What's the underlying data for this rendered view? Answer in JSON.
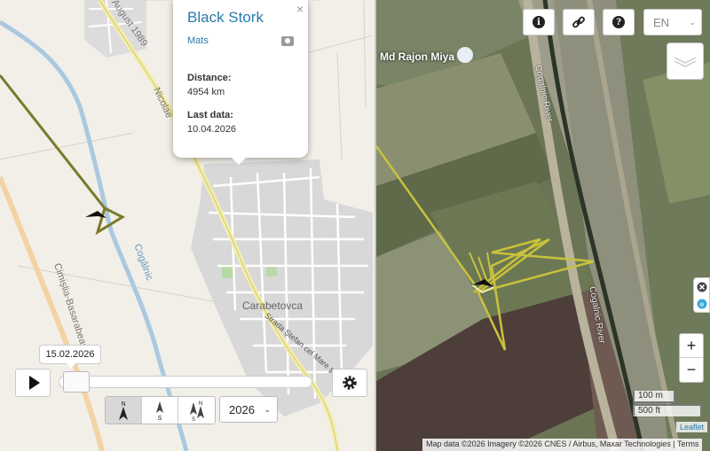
{
  "map_left": {
    "labels": {
      "road_top": "August 1989",
      "road_mid": "Nicolae",
      "river": "Cogâlnic",
      "road_left": "Cimișlia-Basarabeasca",
      "town": "Carabetovca",
      "street": "Strada Ștefan cel Mare și Sfânt"
    }
  },
  "popup": {
    "close": "×",
    "title": "Black Stork",
    "user": "Mats",
    "camera_icon": "camera-icon",
    "distance_label": "Distance:",
    "distance_value": "4954 km",
    "lastdata_label": "Last data:",
    "lastdata_value": "10.04.2026"
  },
  "timeline": {
    "date": "15.02.2026",
    "progress": 0.02,
    "play_icon": "play-icon",
    "settings_icon": "gear-icon",
    "compass": [
      "N",
      "S",
      "NS"
    ],
    "year": "2026"
  },
  "map_right": {
    "place": "Md Rajon Miya",
    "river_labels": [
      "Cogalnic River",
      "Cogalnic River"
    ],
    "lang": "EN",
    "zoom_in": "+",
    "zoom_out": "−",
    "scale_m": "100 m",
    "scale_ft": "500 ft",
    "attribution": "Map data ©2026 Imagery ©2026 CNES / Airbus, Maxar Technologies",
    "terms": "Terms",
    "leaflet": "Leaflet"
  },
  "colors": {
    "track": "#7a7a28",
    "track_sat": "#c9c23c",
    "link": "#2a7aaa"
  }
}
